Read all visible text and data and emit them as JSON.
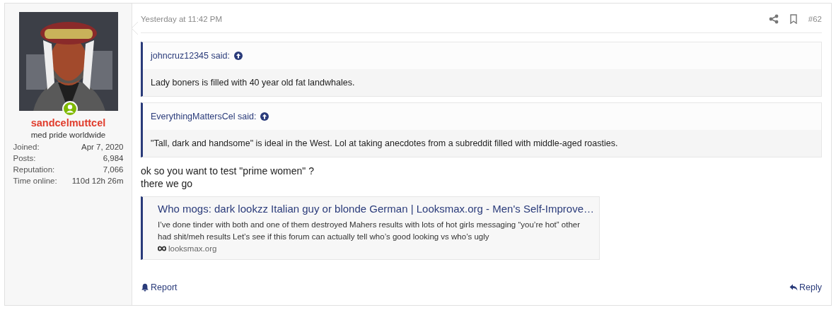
{
  "user": {
    "online": true,
    "name": "sandcelmuttcel",
    "title": "med pride worldwide",
    "stats": [
      {
        "label": "Joined:",
        "value": "Apr 7, 2020"
      },
      {
        "label": "Posts:",
        "value": "6,984"
      },
      {
        "label": "Reputation:",
        "value": "7,066"
      },
      {
        "label": "Time online:",
        "value": "110d 12h 26m"
      }
    ]
  },
  "post": {
    "time": "Yesterday at 11:42 PM",
    "number": "#62",
    "quotes": [
      {
        "author": "johncruz12345 said:",
        "text": "Lady boners is filled with 40 year old fat landwhales."
      },
      {
        "author": "EverythingMattersCel said:",
        "text": "\"Tall, dark and handsome\" is ideal in the West. Lol at taking anecdotes from a subreddit filled with middle-aged roasties."
      }
    ],
    "lines": [
      "ok so you want to test \"prime women\" ?",
      "there we go"
    ],
    "link_preview": {
      "title": "Who mogs: dark lookzz Italian guy or blonde German | Looksmax.org - Men's Self-Improve…",
      "description": "I’ve done tinder with both and one of them destroyed Mahers results with lots of hot girls messaging “you’re hot” other had shit/meh results Let’s see if this forum can actually tell who’s good looking vs who’s ugly",
      "site": "looksmax.org"
    },
    "actions": [
      {
        "kind": "report",
        "label": "Report"
      },
      {
        "kind": "reply",
        "label": "Reply"
      }
    ]
  }
}
